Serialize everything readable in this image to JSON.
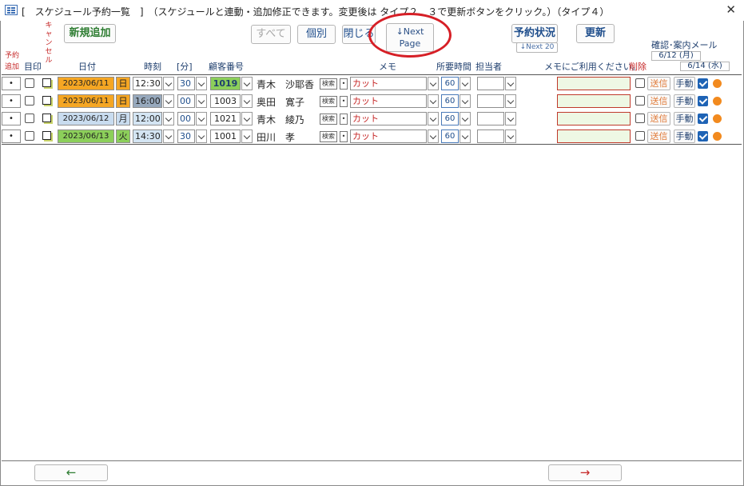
{
  "window": {
    "title": "[　スケジュール予約一覧　]　（スケジュールと連動・追加修正できます。変更後は タイプ２、３で更新ボタンをクリック。）（タイプ４）",
    "close_glyph": "✕"
  },
  "toolbar": {
    "new_add": "新規追加",
    "all": "すべて",
    "individual": "個別",
    "close": "閉じる",
    "next_page_arrow": "↓Next",
    "next_page_label": "Page",
    "reservation_status": "予約状況",
    "next20": "↓Next 20",
    "refresh": "更新"
  },
  "headers": {
    "reserve_add_1": "予約",
    "reserve_add_2": "追加",
    "mark": "目印",
    "cancel": "キャンセル",
    "date": "日付",
    "time": "時刻",
    "minute": "[分]",
    "customer_no": "顧客番号",
    "memo": "メモ",
    "duration": "所要時間",
    "staff": "担当者",
    "memo_use": "メモにご利用ください。",
    "delete": "削除",
    "confirm_mail": "確認･案内メール",
    "mail_date1": "6/12 (月)",
    "mail_date2": "6/14 (水)"
  },
  "rows": [
    {
      "dot": "•",
      "date": "2023/06/11",
      "weekday": "日",
      "hour": "12:30",
      "minute": "30",
      "customer_no": "1019",
      "name": "青木　沙耶香",
      "search": "検索",
      "memo": "カット",
      "duration": "60",
      "send": "送信",
      "manual": "手動"
    },
    {
      "dot": "•",
      "date": "2023/06/11",
      "weekday": "日",
      "hour": "16:00",
      "minute": "00",
      "customer_no": "1003",
      "name": "奥田　寛子",
      "search": "検索",
      "memo": "カット",
      "duration": "60",
      "send": "送信",
      "manual": "手動"
    },
    {
      "dot": "•",
      "date": "2023/06/12",
      "weekday": "月",
      "hour": "12:00",
      "minute": "00",
      "customer_no": "1021",
      "name": "青木　綾乃",
      "search": "検索",
      "memo": "カット",
      "duration": "60",
      "send": "送信",
      "manual": "手動"
    },
    {
      "dot": "•",
      "date": "2023/06/13",
      "weekday": "火",
      "hour": "14:30",
      "minute": "30",
      "customer_no": "1001",
      "name": "田川　孝",
      "search": "検索",
      "memo": "カット",
      "duration": "60",
      "send": "送信",
      "manual": "手動"
    }
  ],
  "footer": {
    "prev": "←",
    "next": "→"
  },
  "colors": {
    "date_orange": "#f5a623",
    "date_blue": "#c9dcef",
    "date_green": "#8ccf5a",
    "time_gray": "#97a9bd",
    "time_light": "#d4e5f3",
    "cust_green": "#8ccf5a",
    "memo_red": "#c62828",
    "send_orange": "#e07b39"
  }
}
